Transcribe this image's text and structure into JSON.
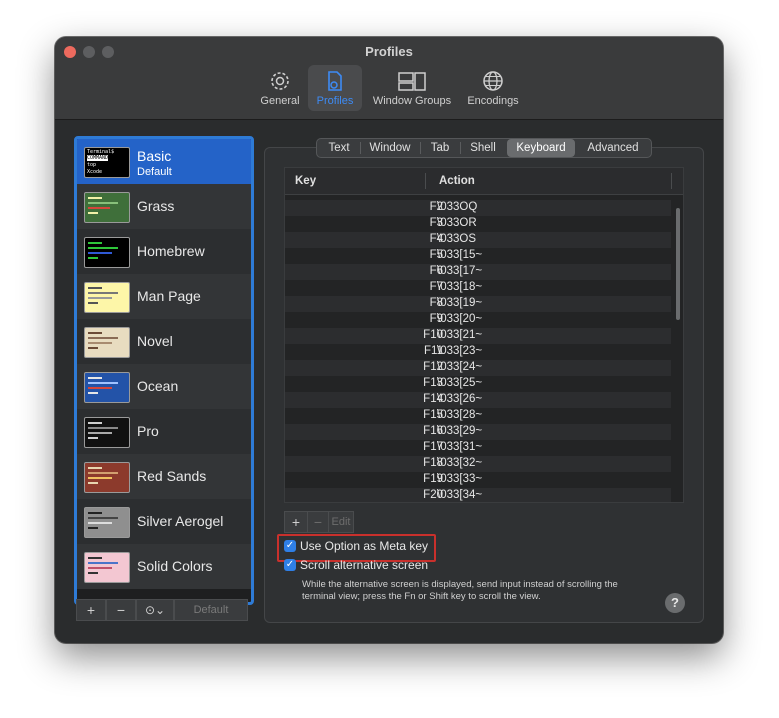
{
  "window": {
    "title": "Profiles"
  },
  "toolbar": {
    "items": [
      {
        "label": "General",
        "icon": "gear-icon",
        "active": false
      },
      {
        "label": "Profiles",
        "icon": "profiles-icon",
        "active": true
      },
      {
        "label": "Window Groups",
        "icon": "window-groups-icon",
        "active": false
      },
      {
        "label": "Encodings",
        "icon": "globe-icon",
        "active": false
      }
    ]
  },
  "sidebar": {
    "profiles": [
      {
        "name": "Basic",
        "subtitle": "Default",
        "selected": true
      },
      {
        "name": "Grass",
        "subtitle": "",
        "selected": false
      },
      {
        "name": "Homebrew",
        "subtitle": "",
        "selected": false
      },
      {
        "name": "Man Page",
        "subtitle": "",
        "selected": false
      },
      {
        "name": "Novel",
        "subtitle": "",
        "selected": false
      },
      {
        "name": "Ocean",
        "subtitle": "",
        "selected": false
      },
      {
        "name": "Pro",
        "subtitle": "",
        "selected": false
      },
      {
        "name": "Red Sands",
        "subtitle": "",
        "selected": false
      },
      {
        "name": "Silver Aerogel",
        "subtitle": "",
        "selected": false
      },
      {
        "name": "Solid Colors",
        "subtitle": "",
        "selected": false
      }
    ],
    "basic_thumb_lines": [
      "Terminal$",
      "COMMAND",
      "top",
      "Xcode"
    ],
    "buttons": {
      "add": "+",
      "remove": "−",
      "more": "⊙⌄",
      "default": "Default"
    }
  },
  "tabs": [
    "Text",
    "Window",
    "Tab",
    "Shell",
    "Keyboard",
    "Advanced"
  ],
  "active_tab": "Keyboard",
  "keyboard_table": {
    "columns": [
      "Key",
      "Action"
    ],
    "rows": [
      {
        "key": "F2",
        "action": "\\033OQ"
      },
      {
        "key": "F3",
        "action": "\\033OR"
      },
      {
        "key": "F4",
        "action": "\\033OS"
      },
      {
        "key": "F5",
        "action": "\\033[15~"
      },
      {
        "key": "F6",
        "action": "\\033[17~"
      },
      {
        "key": "F7",
        "action": "\\033[18~"
      },
      {
        "key": "F8",
        "action": "\\033[19~"
      },
      {
        "key": "F9",
        "action": "\\033[20~"
      },
      {
        "key": "F10",
        "action": "\\033[21~"
      },
      {
        "key": "F11",
        "action": "\\033[23~"
      },
      {
        "key": "F12",
        "action": "\\033[24~"
      },
      {
        "key": "F13",
        "action": "\\033[25~"
      },
      {
        "key": "F14",
        "action": "\\033[26~"
      },
      {
        "key": "F15",
        "action": "\\033[28~"
      },
      {
        "key": "F16",
        "action": "\\033[29~"
      },
      {
        "key": "F17",
        "action": "\\033[31~"
      },
      {
        "key": "F18",
        "action": "\\033[32~"
      },
      {
        "key": "F19",
        "action": "\\033[33~"
      },
      {
        "key": "F20",
        "action": "\\033[34~"
      }
    ]
  },
  "table_buttons": {
    "add": "+",
    "remove": "−",
    "edit": "Edit"
  },
  "options": {
    "use_option_meta": {
      "label": "Use Option as Meta key",
      "checked": true
    },
    "scroll_alt_screen": {
      "label": "Scroll alternative screen",
      "checked": true
    },
    "description": "While the alternative screen is displayed, send input instead of scrolling the terminal view; press the Fn or Shift key to scroll the view."
  },
  "help": "?",
  "colors": {
    "accent": "#2e7bd6",
    "highlight": "#c9302c",
    "window_bg": "#2a2c2d"
  }
}
